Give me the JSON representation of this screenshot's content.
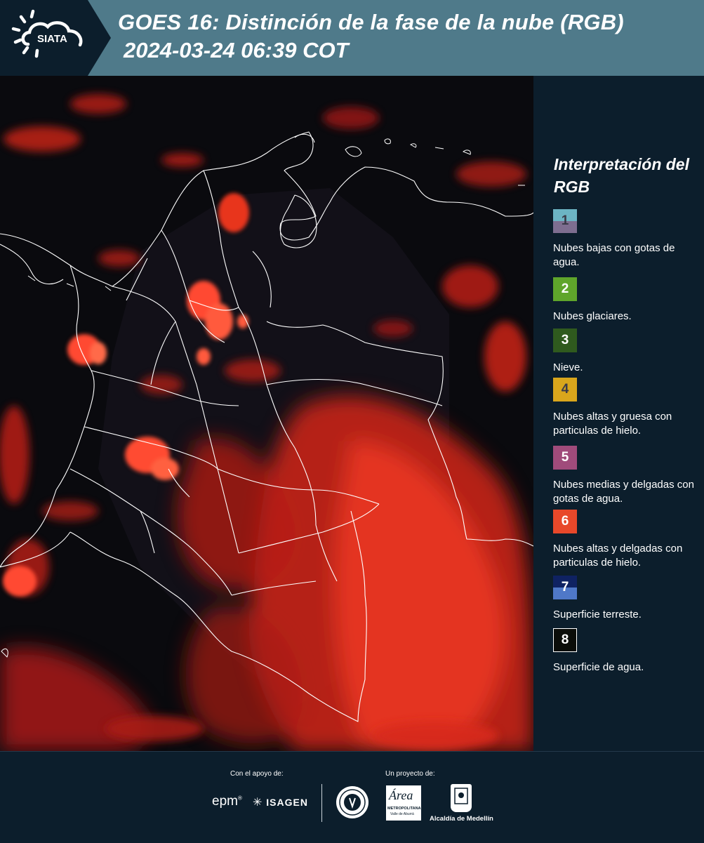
{
  "header": {
    "logo_text": "SIATA",
    "title_line1": "GOES 16: Distinción de la fase de la nube (RGB)",
    "title_line2": "2024-03-24 06:39 COT",
    "bg_color": "#4f7a8a",
    "logo_panel_color": "#0c1e2c"
  },
  "map": {
    "type": "satellite-rgb-composite",
    "region": "Colombia",
    "borders": "white-department-outlines",
    "dominant_color": "#d2261a"
  },
  "legend": {
    "title": "Interpretación del RGB",
    "items": [
      {
        "number": "1",
        "label": "Nubes bajas con gotas de agua.",
        "color_top": "#6cb4c4",
        "color_bottom": "#7e6e90",
        "text_color": "#3a3a48"
      },
      {
        "number": "2",
        "label": "Nubes glaciares.",
        "color": "#5fa52b",
        "text_color": "#ffffff"
      },
      {
        "number": "3",
        "label": "Nieve.",
        "color": "#2f5a1e",
        "text_color": "#ffffff"
      },
      {
        "number": "4",
        "label": "Nubes altas y gruesa con particulas de hielo.",
        "color": "#d9a61c",
        "text_color": "#3a3a48"
      },
      {
        "number": "5",
        "label": "Nubes medias y delgadas con gotas de agua.",
        "color": "#a04b7b",
        "text_color": "#ffffff"
      },
      {
        "number": "6",
        "label": "Nubes altas y delgadas con particulas de hielo.",
        "color": "#e8482a",
        "text_color": "#ffffff"
      },
      {
        "number": "7",
        "label": "Superficie terreste.",
        "color_top": "#0f2262",
        "color_bottom": "#4f78c8",
        "text_color": "#ffffff"
      },
      {
        "number": "8",
        "label": "Superficie de agua.",
        "color": "#0b0d09",
        "text_color": "#ffffff",
        "border_color": "#ffffff"
      }
    ]
  },
  "footer": {
    "support_label": "Con el apoyo de:",
    "project_label": "Un proyecto de:",
    "sponsor_1": "epm",
    "sponsor_2": "ISAGEN",
    "partner_2_name": "Área",
    "partner_2_sub1": "METROPOLITANA",
    "partner_2_sub2": "Valle de Aburrá",
    "partner_3": "Alcaldía de Medellín"
  }
}
